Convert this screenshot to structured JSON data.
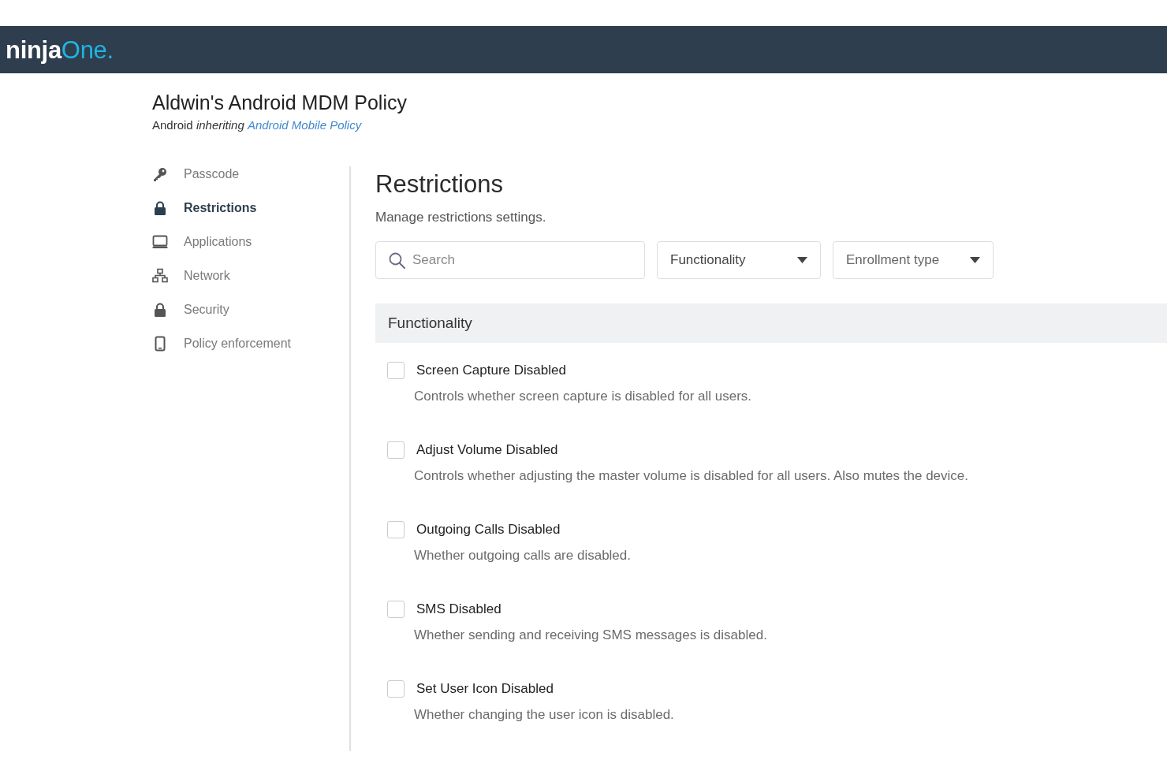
{
  "navbar": {
    "logo": {
      "text": "ninja",
      "accent": "One."
    }
  },
  "page": {
    "title": "Aldwin's Android MDM Policy",
    "subtitle": {
      "text": "Android *inheriting*",
      "link": "Android Mobile Policy"
    }
  },
  "sidebar": {
    "items": [
      {
        "label": "Passcode",
        "selected": false
      },
      {
        "label": "Restrictions",
        "selected": true
      },
      {
        "label": "Applications",
        "selected": false
      },
      {
        "label": "Network",
        "selected": false
      },
      {
        "label": "Security",
        "selected": false
      },
      {
        "label": "Policy enforcement",
        "selected": false
      }
    ]
  },
  "main": {
    "heading": "Restrictions",
    "description": "Manage restrictions settings.",
    "search": {
      "placeholder": "Search"
    },
    "filters": [
      {
        "label": "Functionality",
        "selected": true
      },
      {
        "label": "Enrollment type",
        "selected": false
      }
    ],
    "section": {
      "title": "Functionality",
      "items": [
        {
          "label": "Screen Capture Disabled",
          "description": "Controls whether screen capture is disabled for all users.",
          "checked": false
        },
        {
          "label": "Adjust Volume Disabled",
          "description": "Controls whether adjusting the master volume is disabled for all users. Also mutes the device.",
          "checked": false
        },
        {
          "label": "Outgoing Calls Disabled",
          "description": "Whether outgoing calls are disabled.",
          "checked": false
        },
        {
          "label": "SMS Disabled",
          "description": "Whether sending and receiving SMS messages is disabled.",
          "checked": false
        },
        {
          "label": "Set User Icon Disabled",
          "description": "Whether changing the user icon is disabled.",
          "checked": false
        }
      ]
    }
  }
}
